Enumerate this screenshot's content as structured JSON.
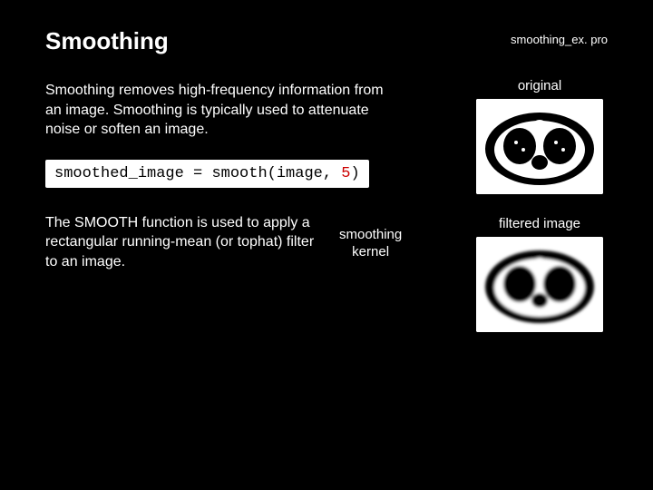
{
  "title": "Smoothing",
  "filename": "smoothing_ex. pro",
  "intro": "Smoothing removes high-frequency information from an image. Smoothing is typically used to attenuate noise or soften an image.",
  "code": {
    "lhs": "smoothed_image = ",
    "func": "smooth",
    "open": "(image, ",
    "arg_num": "5",
    "close": ")"
  },
  "desc": "The SMOOTH function is used to apply a rectangular running-mean (or tophat) filter to an image.",
  "kernel_label_l1": "smoothing",
  "kernel_label_l2": "kernel",
  "right": {
    "label_top": "original",
    "label_bottom": "filtered image"
  }
}
